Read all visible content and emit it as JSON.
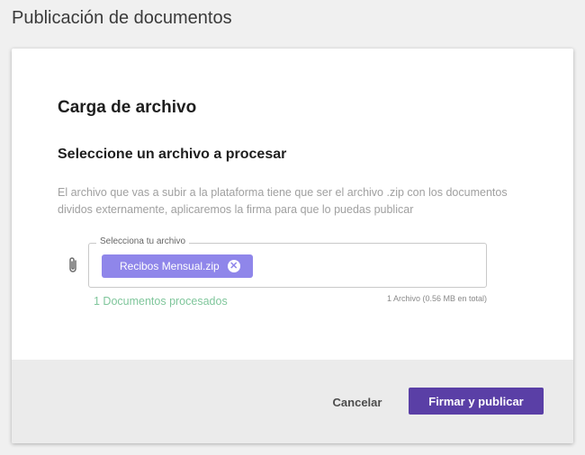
{
  "page": {
    "title": "Publicación de documentos"
  },
  "card": {
    "title": "Carga de archivo",
    "subtitle": "Seleccione un archivo a procesar",
    "description": "El archivo que vas a subir a la plataforma tiene que ser el archivo .zip con los documentos dividos externamente, aplicaremos la firma para que lo puedas publicar"
  },
  "file_input": {
    "label": "Selecciona tu archivo",
    "file_name": "Recibos Mensual.zip",
    "attach_icon": "paperclip-icon",
    "remove_icon": "close-circle-icon"
  },
  "status": {
    "processed_count": "1",
    "processed_text": " Documentos procesados",
    "file_count": "1 Archivo (0.56 MB en total)"
  },
  "actions": {
    "cancel_label": "Cancelar",
    "publish_label": "Firmar y publicar"
  },
  "colors": {
    "accent": "#5a3fa6",
    "chip": "#8f86ea",
    "success": "#7fc69b"
  }
}
